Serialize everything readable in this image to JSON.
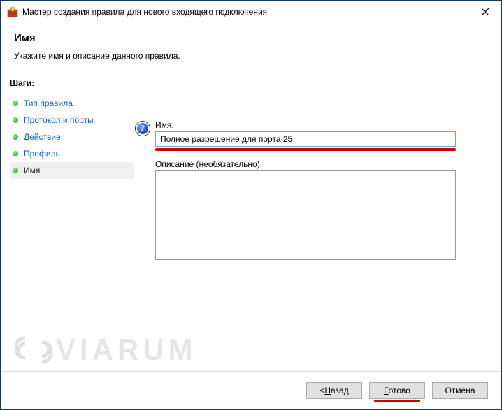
{
  "titlebar": {
    "title": "Мастер создания правила для нового входящего подключения"
  },
  "header": {
    "heading": "Имя",
    "subtitle": "Укажите имя и описание данного правила."
  },
  "sidebar": {
    "title": "Шаги:",
    "steps": [
      {
        "label": "Тип правила"
      },
      {
        "label": "Протокол и порты"
      },
      {
        "label": "Действие"
      },
      {
        "label": "Профиль"
      },
      {
        "label": "Имя"
      }
    ]
  },
  "callout": {
    "number": "7"
  },
  "form": {
    "name_label": "Имя:",
    "name_value": "Полное разрешение для порта 25",
    "desc_label": "Описание (необязательно):",
    "desc_value": ""
  },
  "buttons": {
    "back_prefix": "< ",
    "back_u": "Н",
    "back_rest": "азад",
    "finish_u": "Г",
    "finish_rest": "отово",
    "cancel": "Отмена"
  },
  "watermark": {
    "text": "VIARUM"
  }
}
